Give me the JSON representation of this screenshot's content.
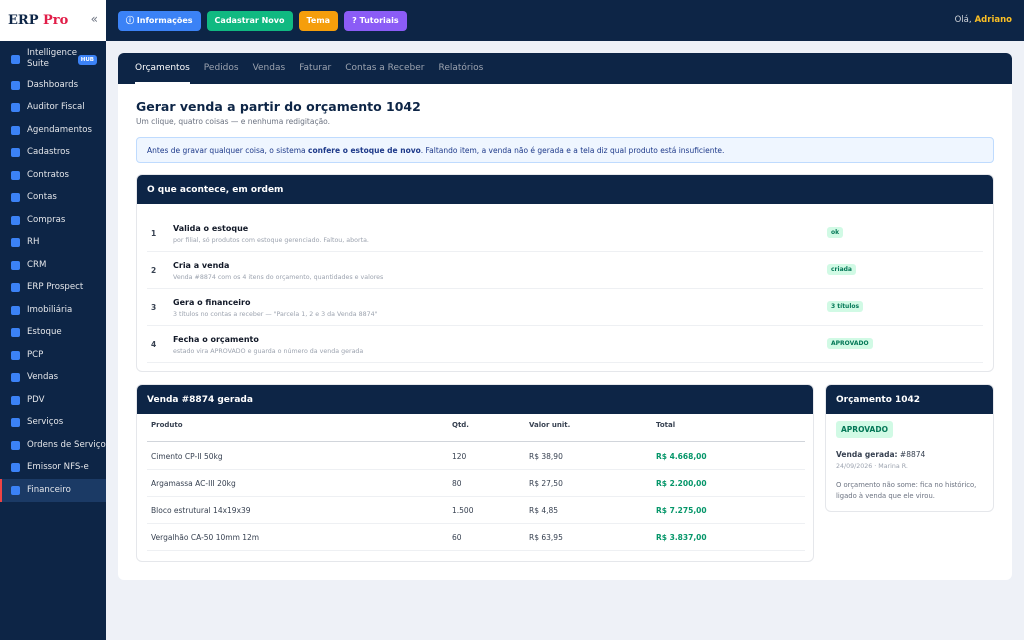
{
  "brand": {
    "name": "ERP",
    "accent": "Pro",
    "collapse_glyph": "«"
  },
  "sidebar": {
    "items": [
      {
        "label": "Intelligence Suite",
        "badge": "HUB"
      },
      {
        "label": "Dashboards"
      },
      {
        "label": "Auditor Fiscal"
      },
      {
        "label": "Agendamentos"
      },
      {
        "label": "Cadastros"
      },
      {
        "label": "Contratos"
      },
      {
        "label": "Contas"
      },
      {
        "label": "Compras"
      },
      {
        "label": "RH"
      },
      {
        "label": "CRM"
      },
      {
        "label": "ERP Prospect"
      },
      {
        "label": "Imobiliária"
      },
      {
        "label": "Estoque"
      },
      {
        "label": "PCP"
      },
      {
        "label": "Vendas"
      },
      {
        "label": "PDV"
      },
      {
        "label": "Serviços"
      },
      {
        "label": "Ordens de Serviço"
      },
      {
        "label": "Emissor NFS-e"
      },
      {
        "label": "Financeiro",
        "active": true
      }
    ]
  },
  "topbar": {
    "buttons": [
      "ⓘ Informações",
      "Cadastrar Novo",
      "Tema",
      "? Tutoriais"
    ],
    "greeting": "Olá,",
    "user": "Adriano"
  },
  "tabs": [
    "Orçamentos",
    "Pedidos",
    "Vendas",
    "Faturar",
    "Contas a Receber",
    "Relatórios"
  ],
  "page": {
    "title": "Gerar venda a partir do orçamento 1042",
    "subtitle": "Um clique, quatro coisas — e nenhuma redigitação.",
    "alert_pre": "Antes de gravar qualquer coisa, o sistema ",
    "alert_bold": "confere o estoque de novo",
    "alert_post": ". Faltando item, a venda não é gerada e a tela diz qual produto está insuficiente."
  },
  "steps": {
    "title": "O que acontece, em ordem",
    "items": [
      {
        "num": "1",
        "title": "Valida o estoque",
        "desc": "por filial, só produtos com estoque gerenciado. Faltou, aborta.",
        "badge": "ok"
      },
      {
        "num": "2",
        "title": "Cria a venda",
        "desc": "Venda #8874 com os 4 itens do orçamento, quantidades e valores",
        "badge": "criada"
      },
      {
        "num": "3",
        "title": "Gera o financeiro",
        "desc": "3 títulos no contas a receber — \"Parcela 1, 2 e 3 da Venda 8874\"",
        "badge": "3 títulos"
      },
      {
        "num": "4",
        "title": "Fecha o orçamento",
        "desc": "estado vira APROVADO e guarda o número da venda gerada",
        "badge": "APROVADO"
      }
    ]
  },
  "venda": {
    "title": "Venda #8874 gerada",
    "headers": [
      "Produto",
      "Qtd.",
      "Valor unit.",
      "Total"
    ],
    "rows": [
      {
        "produto": "Cimento CP-II 50kg",
        "qtd": "120",
        "unit": "R$ 38,90",
        "total": "R$ 4.668,00"
      },
      {
        "produto": "Argamassa AC-III 20kg",
        "qtd": "80",
        "unit": "R$ 27,50",
        "total": "R$ 2.200,00"
      },
      {
        "produto": "Bloco estrutural 14x19x39",
        "qtd": "1.500",
        "unit": "R$ 4,85",
        "total": "R$ 7.275,00"
      },
      {
        "produto": "Vergalhão CA-50 10mm 12m",
        "qtd": "60",
        "unit": "R$ 63,95",
        "total": "R$ 3.837,00"
      }
    ]
  },
  "orcamento": {
    "title": "Orçamento 1042",
    "status": "APROVADO",
    "venda_label": "Venda gerada:",
    "venda_num": "#8874",
    "meta": "24/09/2026 · Marina R.",
    "note": "O orçamento não some: fica no histórico, ligado à venda que ele virou."
  }
}
